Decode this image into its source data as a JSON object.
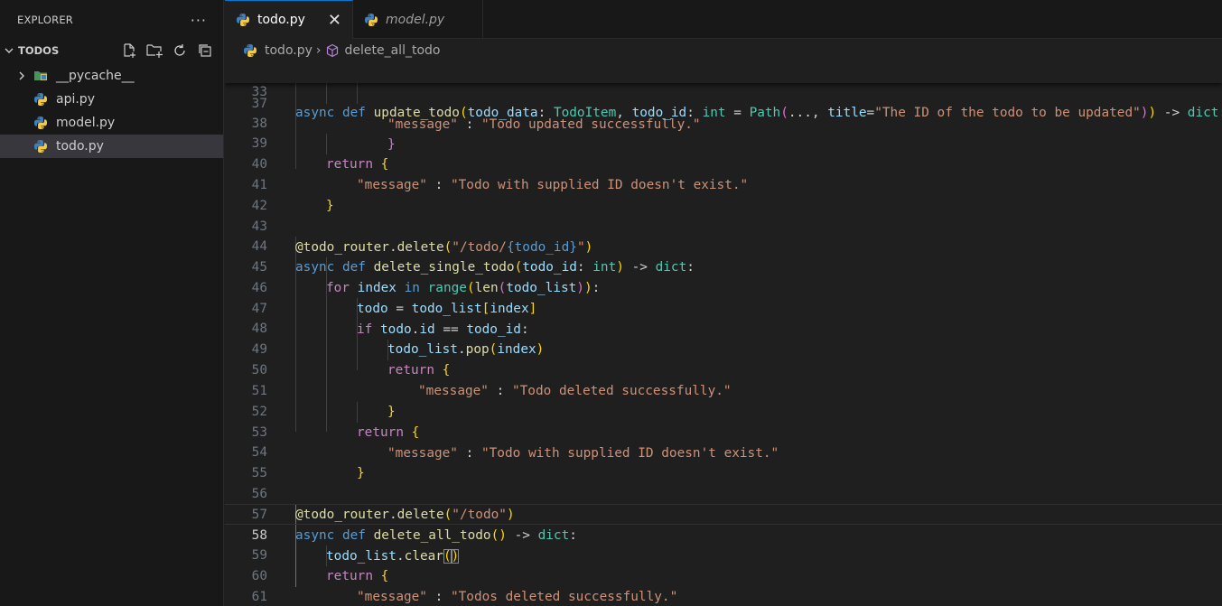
{
  "sidebar": {
    "title": "EXPLORER",
    "more": "···",
    "section": "TODOS",
    "actions": [
      "new-file-icon",
      "new-folder-icon",
      "refresh-icon",
      "collapse-all-icon"
    ],
    "items": [
      {
        "label": "__pycache__",
        "type": "folder"
      },
      {
        "label": "api.py",
        "type": "file"
      },
      {
        "label": "model.py",
        "type": "file"
      },
      {
        "label": "todo.py",
        "type": "file",
        "selected": true
      }
    ]
  },
  "tabs": [
    {
      "label": "todo.py",
      "active": true,
      "close": "✕"
    },
    {
      "label": "model.py",
      "active": false
    }
  ],
  "breadcrumb": {
    "file": "todo.py",
    "symbol": "delete_all_todo",
    "separator": "›"
  },
  "editor": {
    "sticky": {
      "num": "33",
      "text": "async def update_todo(todo_data: TodoItem, todo_id: int = Path(..., title=\"The ID of the todo to be updated\")) -> dict:"
    },
    "partial": {
      "num": "37",
      "text": "\"message\" : \"Todo updated successfully.\""
    },
    "lines": [
      {
        "num": "38",
        "text": "}"
      },
      {
        "num": "39",
        "text": "return {"
      },
      {
        "num": "40",
        "text": "\"message\" : \"Todo with supplied ID doesn't exist.\""
      },
      {
        "num": "41",
        "text": "}"
      },
      {
        "num": "42",
        "text": ""
      },
      {
        "num": "43",
        "text": "@todo_router.delete(\"/todo/{todo_id}\")"
      },
      {
        "num": "44",
        "text": "async def delete_single_todo(todo_id: int) -> dict:"
      },
      {
        "num": "45",
        "text": "for index in range(len(todo_list)):"
      },
      {
        "num": "46",
        "text": "todo = todo_list[index]"
      },
      {
        "num": "47",
        "text": "if todo.id == todo_id:"
      },
      {
        "num": "48",
        "text": "todo_list.pop(index)"
      },
      {
        "num": "49",
        "text": "return {"
      },
      {
        "num": "50",
        "text": "\"message\" : \"Todo deleted successfully.\""
      },
      {
        "num": "51",
        "text": "}"
      },
      {
        "num": "52",
        "text": "return {"
      },
      {
        "num": "53",
        "text": "\"message\" : \"Todo with supplied ID doesn't exist.\""
      },
      {
        "num": "54",
        "text": "}"
      },
      {
        "num": "55",
        "text": ""
      },
      {
        "num": "56",
        "text": "@todo_router.delete(\"/todo\")"
      },
      {
        "num": "57",
        "text": "async def delete_all_todo() -> dict:"
      },
      {
        "num": "58",
        "text": "todo_list.clear()",
        "current": true
      },
      {
        "num": "59",
        "text": "return {"
      },
      {
        "num": "60",
        "text": "\"message\" : \"Todos deleted successfully.\""
      },
      {
        "num": "61",
        "text": "}"
      }
    ]
  },
  "colors": {
    "accent": "#0078d4",
    "python_blue": "#3776ab",
    "python_yellow": "#ffd43b"
  }
}
